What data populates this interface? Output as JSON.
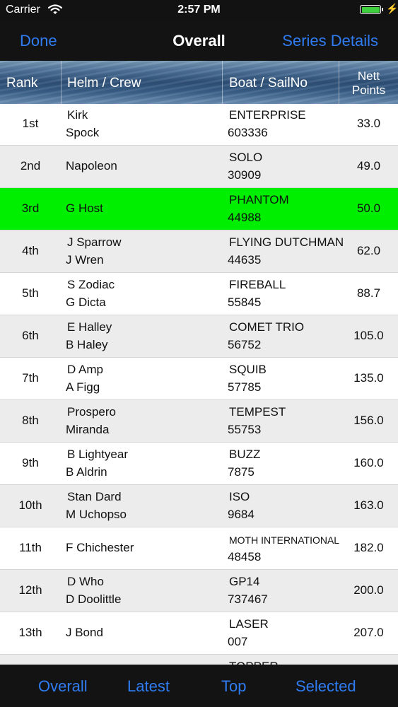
{
  "status_bar": {
    "carrier": "Carrier",
    "time": "2:57 PM",
    "bolt": "⚡"
  },
  "nav": {
    "done_label": "Done",
    "title": "Overall",
    "series_label": "Series Details"
  },
  "columns": {
    "rank": "Rank",
    "helm": "Helm / Crew",
    "boat": "Boat / SailNo",
    "points_line1": "Nett",
    "points_line2": "Points"
  },
  "rows": [
    {
      "rank": "1st",
      "helm": "Kirk",
      "crew": "Spock",
      "boat": "ENTERPRISE",
      "sail": "603336",
      "points": "33.0"
    },
    {
      "rank": "2nd",
      "helm": "Napoleon",
      "crew": "",
      "boat": "SOLO",
      "sail": "30909",
      "points": "49.0"
    },
    {
      "rank": "3rd",
      "helm": "G Host",
      "crew": "",
      "boat": "PHANTOM",
      "sail": "44988",
      "points": "50.0",
      "highlight": true
    },
    {
      "rank": "4th",
      "helm": "J Sparrow",
      "crew": "J Wren",
      "boat": "FLYING DUTCHMAN",
      "sail": "44635",
      "points": "62.0"
    },
    {
      "rank": "5th",
      "helm": "S Zodiac",
      "crew": "G Dicta",
      "boat": "FIREBALL",
      "sail": "55845",
      "points": "88.7"
    },
    {
      "rank": "6th",
      "helm": "E Halley",
      "crew": "B Haley",
      "boat": "COMET TRIO",
      "sail": "56752",
      "points": "105.0"
    },
    {
      "rank": "7th",
      "helm": "D Amp",
      "crew": "A Figg",
      "boat": "SQUIB",
      "sail": "57785",
      "points": "135.0"
    },
    {
      "rank": "8th",
      "helm": "Prospero",
      "crew": "Miranda",
      "boat": "TEMPEST",
      "sail": "55753",
      "points": "156.0"
    },
    {
      "rank": "9th",
      "helm": "B Lightyear",
      "crew": "B Aldrin",
      "boat": "BUZZ",
      "sail": "7875",
      "points": "160.0"
    },
    {
      "rank": "10th",
      "helm": "Stan Dard",
      "crew": "M Uchopso",
      "boat": "ISO",
      "sail": "9684",
      "points": "163.0"
    },
    {
      "rank": "11th",
      "helm": "F Chichester",
      "crew": "",
      "boat": "MOTH INTERNATIONAL",
      "sail": "48458",
      "points": "182.0",
      "small_boat": true
    },
    {
      "rank": "12th",
      "helm": "D Who",
      "crew": "D Doolittle",
      "boat": "GP14",
      "sail": "737467",
      "points": "200.0"
    },
    {
      "rank": "13th",
      "helm": "J Bond",
      "crew": "",
      "boat": "LASER",
      "sail": "007",
      "points": "207.0"
    },
    {
      "rank": "",
      "helm": "",
      "crew": "",
      "boat": "TOPPER",
      "sail": "",
      "points": ""
    }
  ],
  "tabs": [
    {
      "label": "Overall"
    },
    {
      "label": "Latest"
    },
    {
      "label": "Top"
    },
    {
      "label": "Selected"
    }
  ],
  "colors": {
    "accent": "#2f7cf2",
    "highlight": "#00ee00",
    "bar_bg": "#131313"
  }
}
